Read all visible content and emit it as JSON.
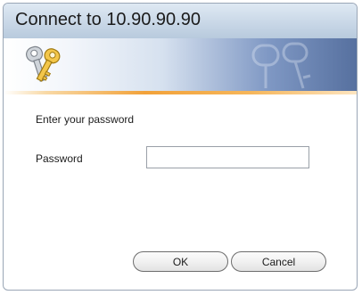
{
  "window": {
    "title": "Connect to 10.90.90.90"
  },
  "banner": {
    "icon": "keys-icon",
    "watermark": "keys-watermark-icon"
  },
  "form": {
    "prompt": "Enter your password",
    "password_label": "Password",
    "password_value": "",
    "password_placeholder": ""
  },
  "buttons": {
    "ok_label": "OK",
    "cancel_label": "Cancel"
  },
  "colors": {
    "titlebar": "#c7d6e6",
    "accent_line": "#f2a23a",
    "banner_dark": "#56709f"
  }
}
